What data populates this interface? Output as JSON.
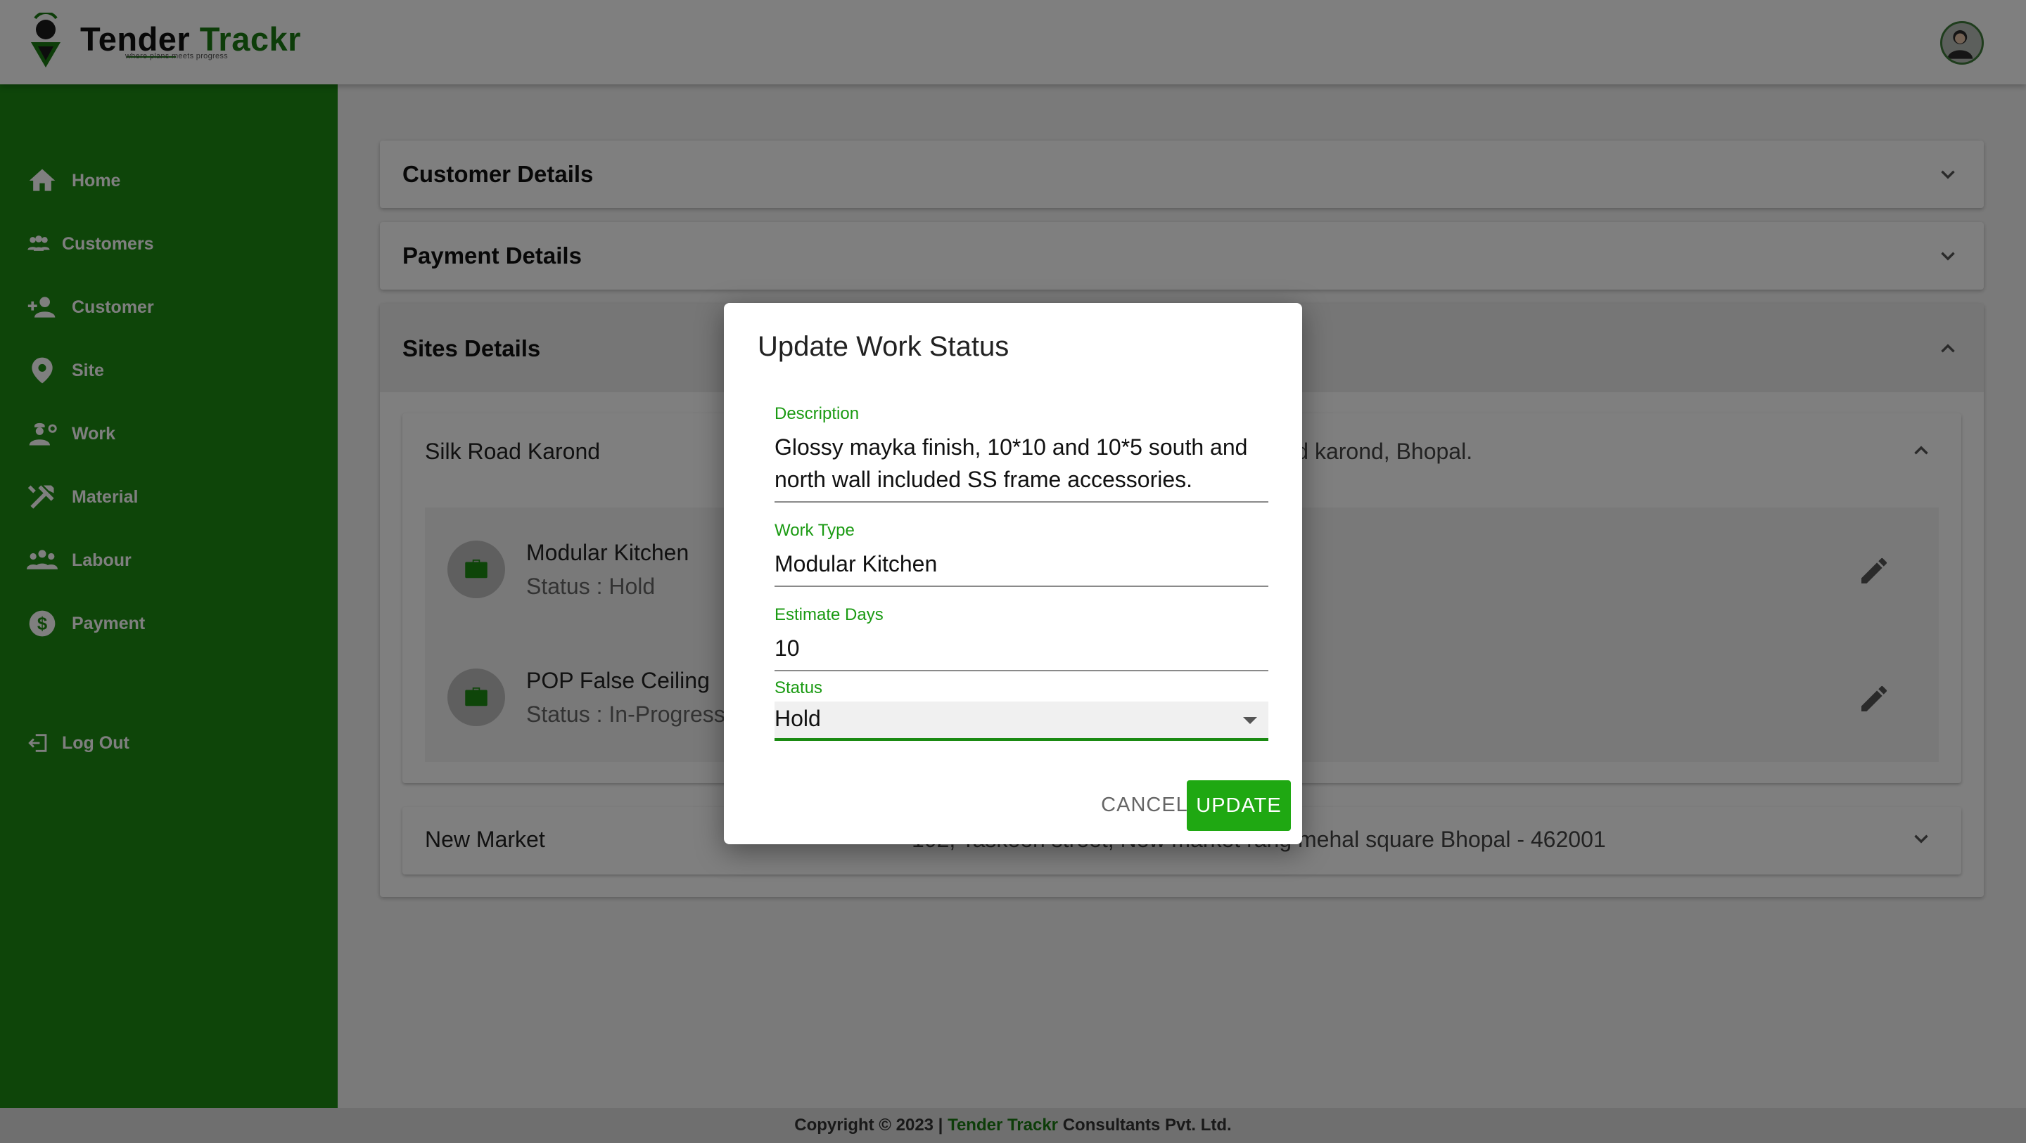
{
  "header": {
    "brand_a": "Tender ",
    "brand_b": "Trackr",
    "tagline": "where plans meets progress"
  },
  "sidebar": {
    "items": [
      {
        "label": "Home",
        "icon": "home-icon"
      },
      {
        "label": "Customers",
        "icon": "customers-icon"
      },
      {
        "label": "Customer",
        "icon": "add-customer-icon"
      },
      {
        "label": "Site",
        "icon": "location-pin-icon"
      },
      {
        "label": "Work",
        "icon": "worker-icon"
      },
      {
        "label": "Material",
        "icon": "tools-icon"
      },
      {
        "label": "Labour",
        "icon": "labour-group-icon"
      },
      {
        "label": "Payment",
        "icon": "dollar-icon"
      }
    ],
    "logout": "Log Out"
  },
  "main": {
    "customer_details": "Customer Details",
    "payment_details": "Payment Details",
    "sites_details": "Sites Details",
    "sites": [
      {
        "name": "Silk Road Karond",
        "address": "road karond, Bhopal.",
        "works": [
          {
            "title": "Modular Kitchen",
            "status": "Status : Hold"
          },
          {
            "title": "POP False Ceiling",
            "status": "Status : In-Progress"
          }
        ]
      },
      {
        "name": "New Market",
        "address": "102, Taskeen street, New market rang mehal square Bhopal - 462001"
      }
    ]
  },
  "footer": {
    "prefix": "Copyright © 2023 | ",
    "brand": "Tender Trackr",
    "suffix": " Consultants Pvt. Ltd."
  },
  "dialog": {
    "title": "Update Work Status",
    "description_label": "Description",
    "description_value": "Glossy mayka finish, 10*10 and 10*5 south and north wall included SS frame accessories.",
    "work_type_label": "Work Type",
    "work_type_value": "Modular Kitchen",
    "estimate_label": "Estimate Days",
    "estimate_value": "10",
    "status_label": "Status",
    "status_value": "Hold",
    "cancel_label": "CANCEL",
    "update_label": "UPDATE"
  },
  "colors": {
    "brand_green": "#1c8a13",
    "accent_green": "#1fa812",
    "text_dark": "#222222"
  }
}
